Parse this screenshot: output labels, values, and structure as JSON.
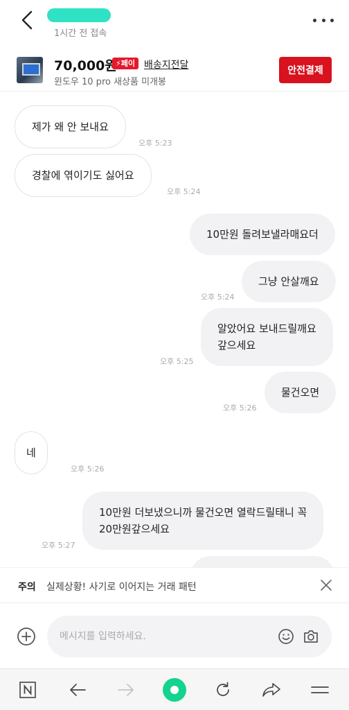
{
  "header": {
    "last_seen": "1시간 전 접속"
  },
  "product": {
    "price": "70,000원",
    "pay_badge": "⚡페이",
    "shipping": "배송지전달",
    "name": "윈도우 10 pro 새상품 미개봉",
    "pay_button": "안전결제"
  },
  "messages": [
    {
      "dir": "in",
      "text": "제가 왜 안 보내요",
      "time": "오후 5:23"
    },
    {
      "dir": "in",
      "text": "경찰에 엮이기도 싫어요",
      "time": "오후 5:24"
    },
    {
      "dir": "out",
      "text": "10만원 돌려보낼라매요더",
      "time": ""
    },
    {
      "dir": "out",
      "text": "그냥 안살깨요",
      "time": "오후 5:24"
    },
    {
      "dir": "out",
      "text_lines": [
        "알았어요 보내드릴깨요",
        "갚으세요"
      ],
      "time": "오후 5:25"
    },
    {
      "dir": "out",
      "text": "물건오면",
      "time": "오후 5:26"
    },
    {
      "dir": "in",
      "text": "네",
      "time": "오후 5:26"
    },
    {
      "dir": "out",
      "text_lines": [
        "10만원 더보냈으니까 물건오면 열락드릴태니 꼭",
        "20만원갚으세요"
      ],
      "time": "오후 5:27"
    }
  ],
  "notice": {
    "label": "주의",
    "text": "실제상황! 사기로 이어지는 거래 패턴"
  },
  "composer": {
    "placeholder": "메시지를 입력하세요."
  },
  "icons": {
    "back": "back-chevron-icon",
    "more": "more-dots-icon",
    "close": "close-icon",
    "plus": "plus-circle-icon",
    "emoji": "smiley-icon",
    "camera": "camera-icon",
    "naver": "naver-n-icon",
    "browser_back": "arrow-left-icon",
    "browser_forward": "arrow-right-icon",
    "home": "green-dot-icon",
    "refresh": "refresh-icon",
    "share": "share-icon",
    "menu": "hamburger-icon"
  },
  "colors": {
    "accent_red": "#d8121e",
    "user_blur": "#2fe2c4",
    "home_green": "#13d38e"
  }
}
